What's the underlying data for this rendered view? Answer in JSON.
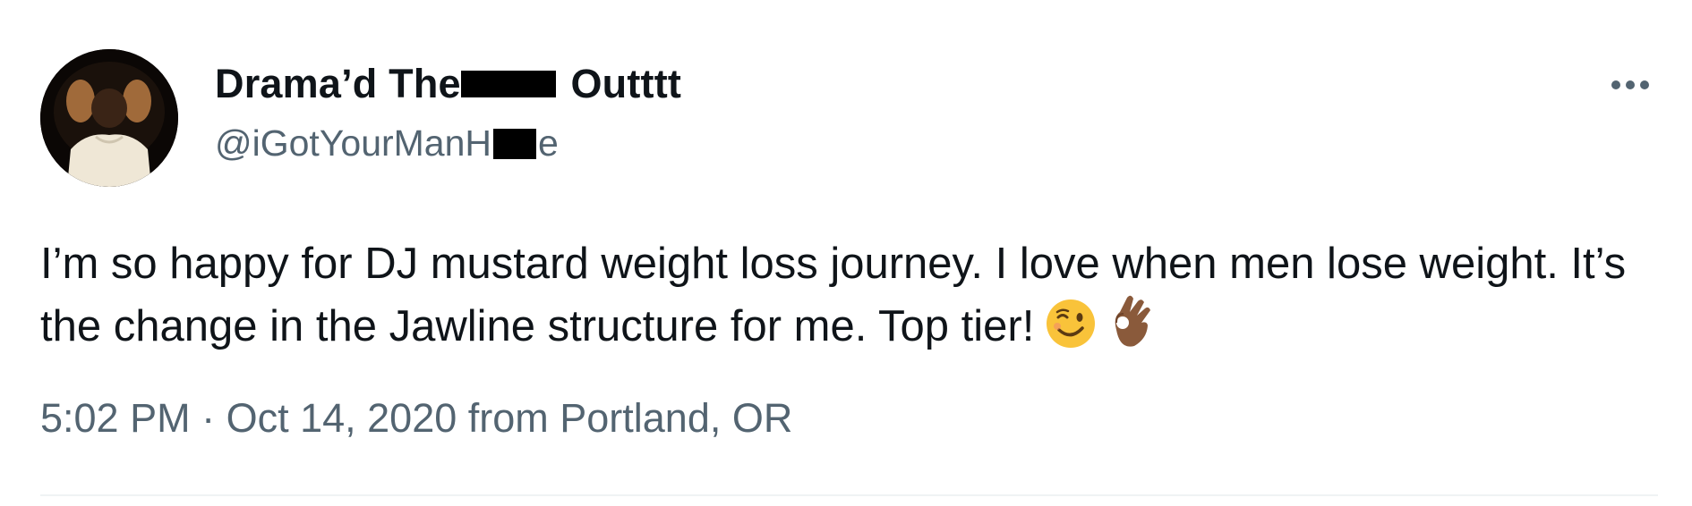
{
  "author": {
    "display_name_start": "Drama’d The",
    "display_name_end": " Outttt",
    "handle_start": "@iGotYourManH",
    "handle_end": "e"
  },
  "tweet": {
    "text": "I’m so happy for DJ mustard weight loss journey. I love when men lose weight. It’s the change in the Jawline structure for me. Top tier!",
    "emojis": [
      "winking-face-emoji",
      "ok-hand-medium-dark-skin-emoji"
    ]
  },
  "meta": {
    "timestamp": "5:02 PM · Oct 14, 2020 from Portland, OR"
  },
  "icons": {
    "more": "more-horizontal-icon"
  },
  "colors": {
    "text_primary": "#0f1419",
    "text_secondary": "#536471",
    "divider": "#eff3f4",
    "redaction": "#000000"
  }
}
